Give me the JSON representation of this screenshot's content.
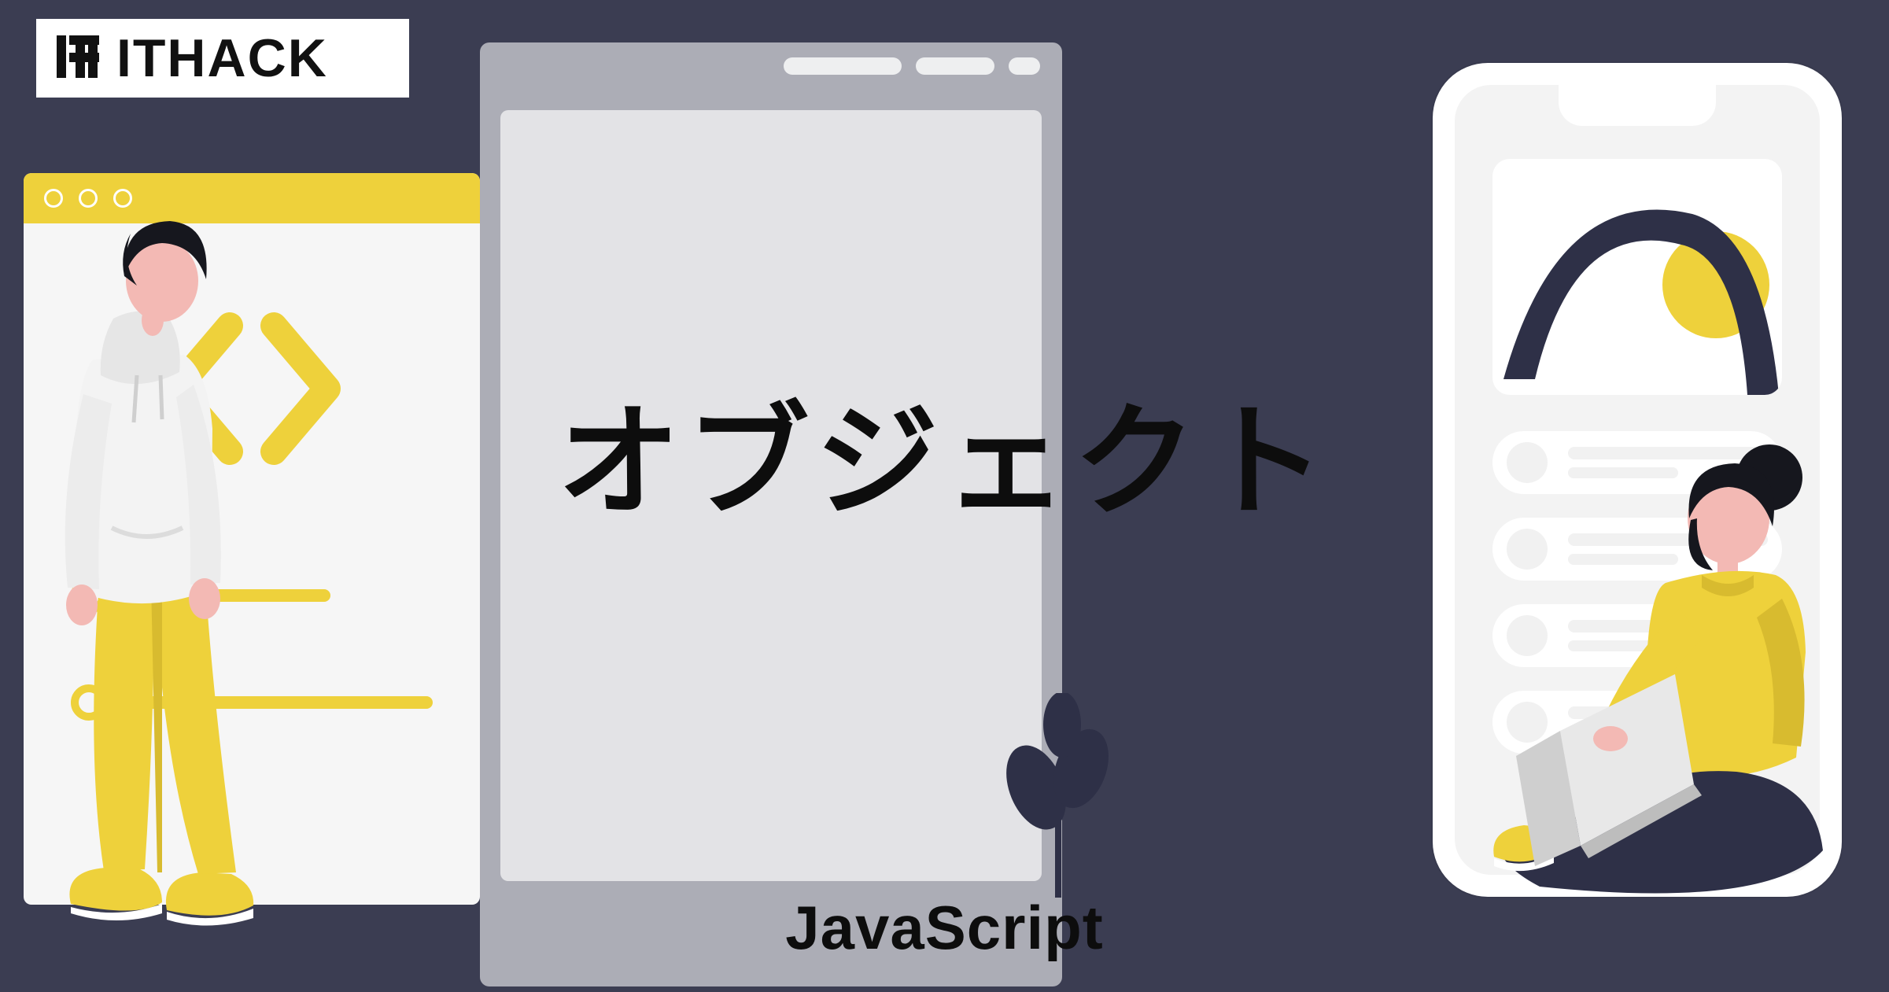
{
  "logo": {
    "text": "ITHACK"
  },
  "titles": {
    "main": "オブジェクト",
    "sub": "JavaScript"
  },
  "colors": {
    "background": "#3b3d52",
    "accent_yellow": "#eed13b",
    "navy": "#2e3047",
    "skin": "#f3b9b4",
    "hair": "#16171e",
    "white": "#ffffff"
  },
  "icons": {
    "logo_mark": "ithack-logo-icon",
    "code_brackets": "code-angle-brackets-icon",
    "plant": "plant-icon"
  },
  "illustrations": {
    "left_person": "standing-developer-illustration",
    "right_person": "seated-laptop-user-illustration",
    "phone": "smartphone-mockup",
    "browser": "browser-window-mockup",
    "modal": "translucent-panel"
  }
}
